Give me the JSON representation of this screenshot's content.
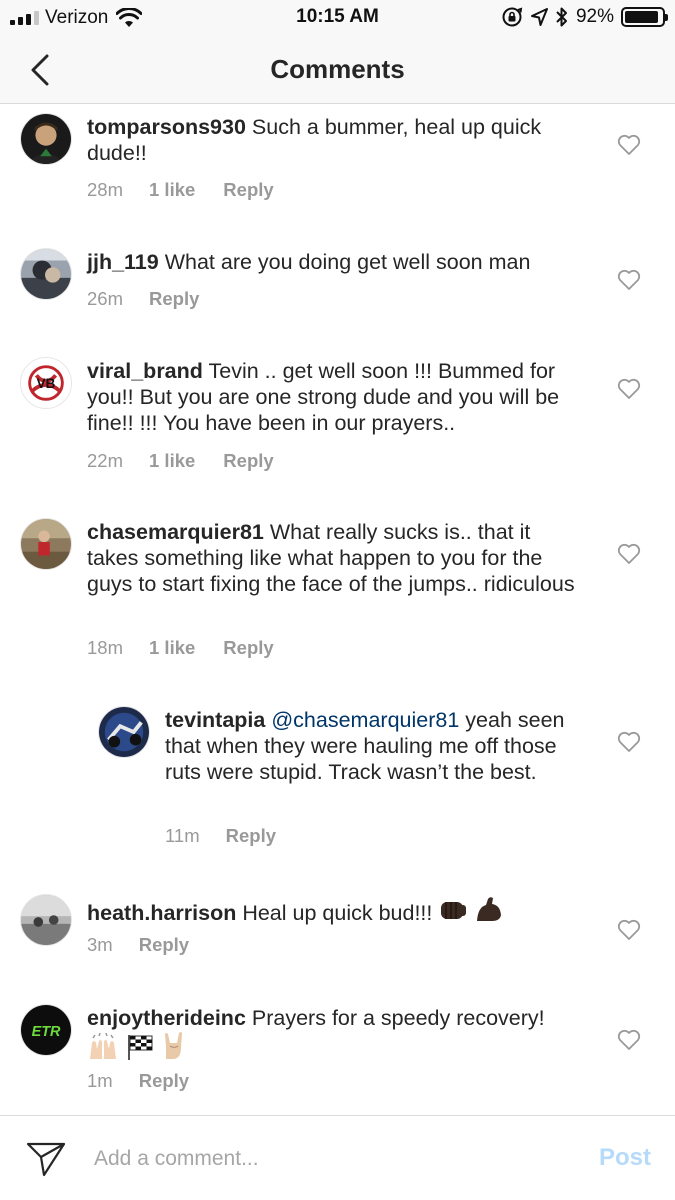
{
  "status_bar": {
    "carrier": "Verizon",
    "time": "10:15 AM",
    "battery_percent": "92%",
    "battery_level": 0.92,
    "signal_bars": 3
  },
  "header": {
    "title": "Comments",
    "back_icon": "chevron-left-icon"
  },
  "comments": [
    {
      "username": "tomparsons930",
      "text": "Such a bummer, heal up quick dude!!",
      "time": "28m",
      "likes": "1 like",
      "reply": "Reply"
    },
    {
      "username": "jjh_119",
      "text": "What are you doing get well soon man",
      "time": "26m",
      "likes": "",
      "reply": "Reply"
    },
    {
      "username": "viral_brand",
      "text": "Tevin .. get well soon !!! Bummed for you!! But you are one strong dude and you will be fine!! !!! You have been in our prayers..",
      "time": "22m",
      "likes": "1 like",
      "reply": "Reply"
    },
    {
      "username": "chasemarquier81",
      "text": "What really sucks is.. that it takes something like what happen to you for the guys to start fixing the face of the jumps.. ridiculous",
      "time": "18m",
      "likes": "1 like",
      "reply": "Reply"
    },
    {
      "username": "tevintapia",
      "mention": "@chasemarquier81",
      "text": "yeah seen that when they were hauling me off those ruts were stupid. Track wasn’t the best.",
      "time": "11m",
      "likes": "",
      "reply": "Reply"
    },
    {
      "username": "heath.harrison",
      "text": "Heal up quick bud!!!",
      "time": "3m",
      "likes": "",
      "reply": "Reply"
    },
    {
      "username": "enjoytherideinc",
      "text": "Prayers for a speedy recovery!",
      "time": "1m",
      "likes": "",
      "reply": "Reply"
    }
  ],
  "composer": {
    "placeholder": "Add a comment...",
    "post_label": "Post",
    "post_color": "#b6dafa"
  },
  "colors": {
    "mention": "#003569",
    "meta": "#999999",
    "text": "#262626"
  }
}
